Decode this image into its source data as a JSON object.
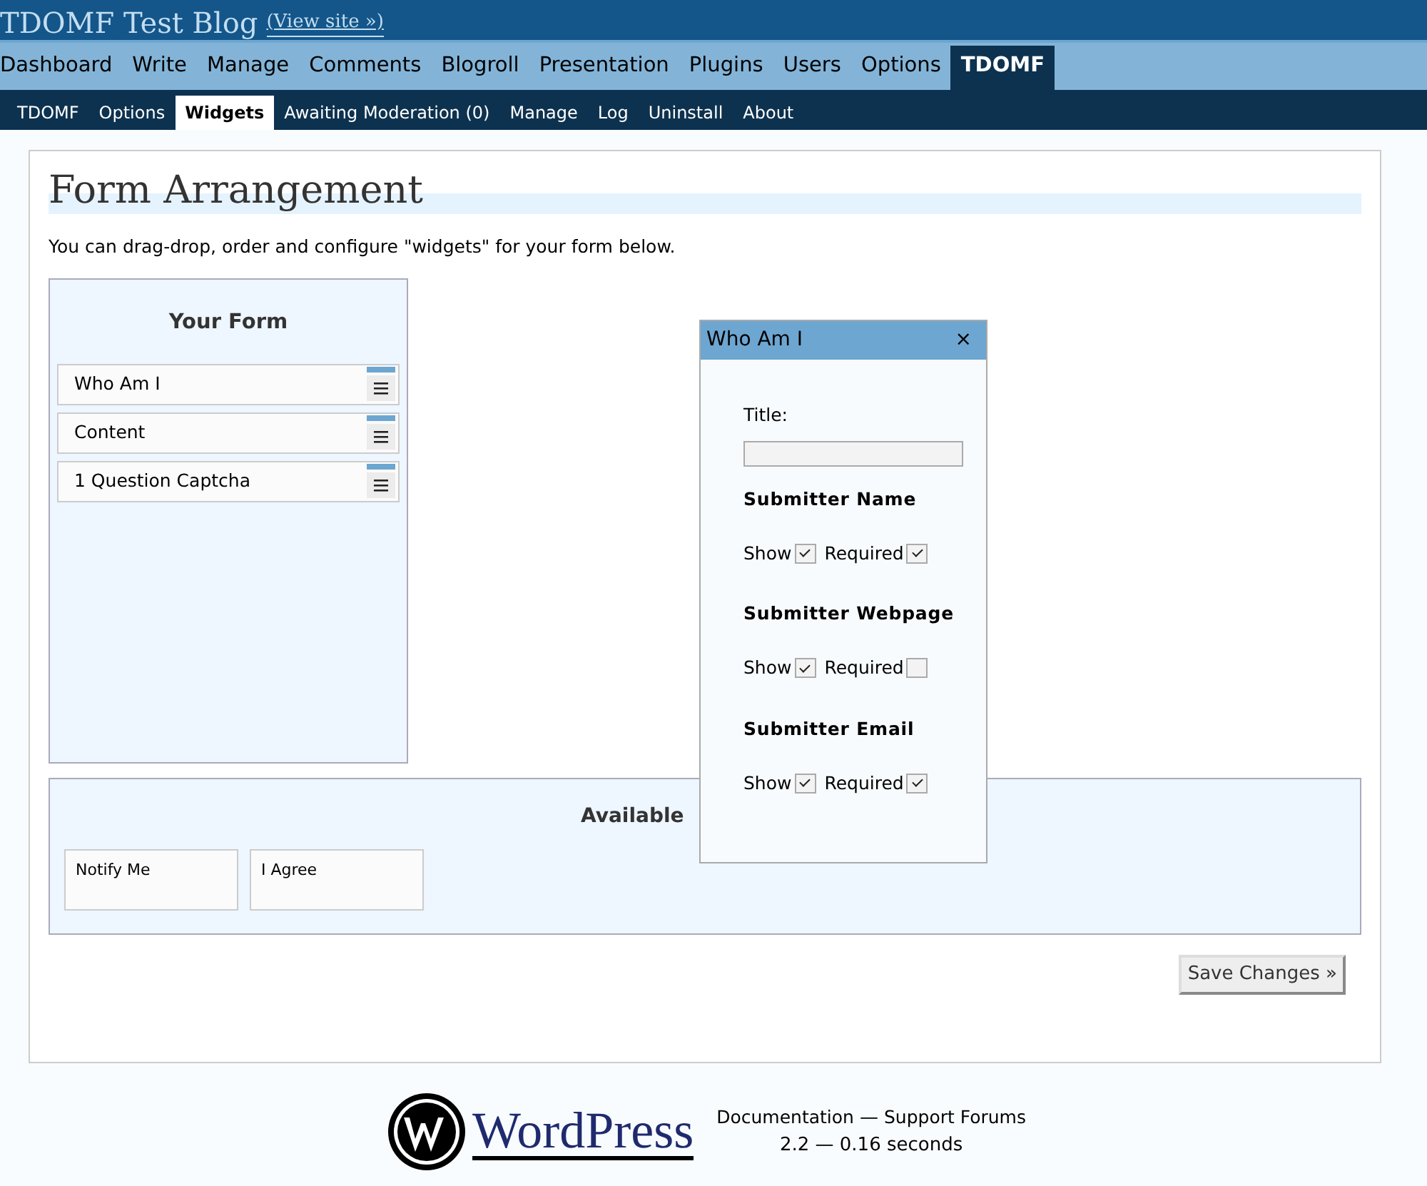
{
  "header": {
    "title": "TDOMF Test Blog",
    "view_site": "(View site »)"
  },
  "menu": [
    {
      "label": "Dashboard",
      "selected": false
    },
    {
      "label": "Write",
      "selected": false
    },
    {
      "label": "Manage",
      "selected": false
    },
    {
      "label": "Comments",
      "selected": false
    },
    {
      "label": "Blogroll",
      "selected": false
    },
    {
      "label": "Presentation",
      "selected": false
    },
    {
      "label": "Plugins",
      "selected": false
    },
    {
      "label": "Users",
      "selected": false
    },
    {
      "label": "Options",
      "selected": false
    },
    {
      "label": "TDOMF",
      "selected": true
    }
  ],
  "submenu": [
    {
      "label": "TDOMF",
      "selected": false
    },
    {
      "label": "Options",
      "selected": false
    },
    {
      "label": "Widgets",
      "selected": true
    },
    {
      "label": "Awaiting Moderation (0)",
      "selected": false
    },
    {
      "label": "Manage",
      "selected": false
    },
    {
      "label": "Log",
      "selected": false
    },
    {
      "label": "Uninstall",
      "selected": false
    },
    {
      "label": "About",
      "selected": false
    }
  ],
  "page": {
    "title": "Form Arrangement",
    "intro": "You can drag-drop, order and configure \"widgets\" for your form below."
  },
  "your_form": {
    "title": "Your Form",
    "widgets": [
      "Who Am I",
      "Content",
      "1 Question Captcha"
    ]
  },
  "available": {
    "title": "Available",
    "widgets": [
      "Notify Me",
      "I Agree"
    ]
  },
  "dialog": {
    "title": "Who Am I",
    "close": "×",
    "title_label": "Title:",
    "sections": [
      {
        "heading": "Submitter Name",
        "show_label": "Show",
        "show": true,
        "required_label": "Required",
        "required": true
      },
      {
        "heading": "Submitter Webpage",
        "show_label": "Show",
        "show": true,
        "required_label": "Required",
        "required": false
      },
      {
        "heading": "Submitter Email",
        "show_label": "Show",
        "show": true,
        "required_label": "Required",
        "required": true
      }
    ]
  },
  "save_button": "Save Changes »",
  "footer": {
    "logo": "WordPress",
    "links": [
      "Documentation",
      "Support Forums"
    ],
    "separator": "—",
    "version": "2.2 — 0.16 seconds"
  }
}
